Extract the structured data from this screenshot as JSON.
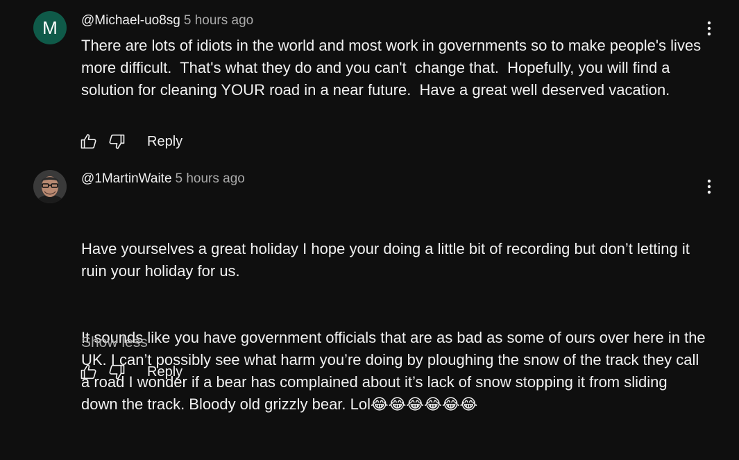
{
  "comments": [
    {
      "avatar_letter": "M",
      "avatar_color": "#0f5a49",
      "author": "@Michael-uo8sg",
      "time": "5 hours ago",
      "text": "There are lots of idiots in the world and most work in governments so to make people's lives more difficult.  That's what they do and you can't  change that.  Hopefully, you will find a solution for cleaning YOUR road in a near future.  Have a great well deserved vacation.",
      "reply_label": "Reply",
      "like_icon": "thumbs-up-icon",
      "dislike_icon": "thumbs-down-icon",
      "menu_icon": "more-vertical-icon"
    },
    {
      "avatar_image": "profile photo",
      "author": "@1MartinWaite",
      "time": "5 hours ago",
      "text_line1": "Have yourselves a great holiday I hope your doing a little bit of recording but don’t letting it ruin your holiday for us.",
      "text_line2": "It sounds like you have government officials that are as bad as some of ours over here in the UK. I can’t possibly see what harm you’re doing by ploughing the snow of the track they call a road I wonder if a bear has complained about it’s lack of snow stopping it from sliding down the track. Bloody old grizzly bear. Lol😂😂😂😂😂😂",
      "show_less_label": "Show less",
      "reply_label": "Reply",
      "like_icon": "thumbs-up-icon",
      "dislike_icon": "thumbs-down-icon",
      "menu_icon": "more-vertical-icon"
    }
  ]
}
